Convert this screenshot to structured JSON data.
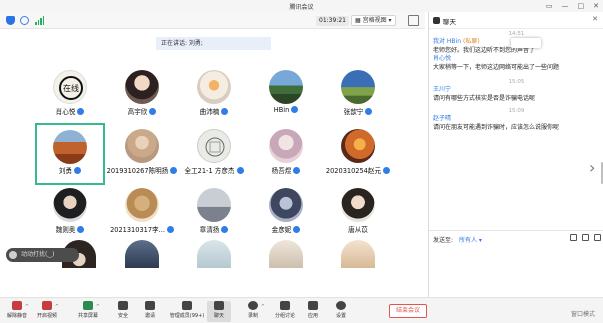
{
  "window": {
    "title": "腾讯会议",
    "controls": [
      "▭",
      "—",
      "□",
      "✕"
    ]
  },
  "topbar": {
    "timer": "01:39:21",
    "view_mode": "▦ 宫格视图 ▾",
    "icons": [
      "shield-icon",
      "info-icon",
      "signal-icon",
      "fullscreen-icon"
    ]
  },
  "speaker_banner": "正在讲话: 刘勇;",
  "participants": [
    {
      "name": "肖心悦",
      "mic_on": true
    },
    {
      "name": "高宇欣",
      "mic_on": true
    },
    {
      "name": "曲沛楠",
      "mic_on": true
    },
    {
      "name": "HBin",
      "mic_on": true
    },
    {
      "name": "张歆宁",
      "mic_on": true
    },
    {
      "name": "刘勇",
      "mic_on": true,
      "active": true
    },
    {
      "name": "2019310267陈明扬",
      "mic_on": true
    },
    {
      "name": "全工21-1 方彦杰",
      "mic_on": true
    },
    {
      "name": "杨吾煜",
      "mic_on": true
    },
    {
      "name": "2020310254赵元",
      "mic_on": true
    },
    {
      "name": "魏则奥",
      "mic_on": true
    },
    {
      "name": "2021310317李...",
      "mic_on": true
    },
    {
      "name": "章清扬",
      "mic_on": true
    },
    {
      "name": "金彦妮",
      "mic_on": true
    },
    {
      "name": "唐从苡",
      "mic_on": false
    }
  ],
  "hand_button": "动动打扰(‿)",
  "bottom_toolbar": {
    "items": [
      {
        "label": "解除静音",
        "icon": "mic-icon"
      },
      {
        "label": "开启视频",
        "icon": "camera-icon"
      },
      {
        "label": "共享屏幕",
        "icon": "share-screen-icon"
      },
      {
        "label": "安全",
        "icon": "shield-icon"
      },
      {
        "label": "邀请",
        "icon": "invite-icon"
      },
      {
        "label": "管理成员(99+)",
        "icon": "members-icon"
      },
      {
        "label": "聊天",
        "icon": "chat-icon",
        "selected": true
      },
      {
        "label": "录制",
        "icon": "record-icon"
      },
      {
        "label": "分组讨论",
        "icon": "breakout-icon"
      },
      {
        "label": "应用",
        "icon": "apps-icon"
      },
      {
        "label": "设置",
        "icon": "settings-icon"
      }
    ],
    "leave_label": "结束会议",
    "window_mode": "窗口模式"
  },
  "chat": {
    "title": "聊天",
    "messages": [
      {
        "time": "14:51",
        "sender": "我对 HBin",
        "private_tag": "(私聊)",
        "text": "老师您好。我们这边听不到您的声音了"
      },
      {
        "time": "",
        "sender": "肖心悦",
        "private_tag": "",
        "text": "大家稍等一下，老师这边网络可能出了一些问题"
      },
      {
        "time": "15:05",
        "sender": "王川宁",
        "private_tag": "",
        "text": "请问有哪些方式核实是否是诈骗电话呢"
      },
      {
        "time": "15:09",
        "sender": "赵子晴",
        "private_tag": "",
        "text": "请问在朋友可能遇到诈骗时，应该怎么说服你呢"
      }
    ],
    "send_to_label": "发送至:",
    "send_to_target": "所有人 ▾"
  },
  "colors": {
    "accent": "#2f7de6",
    "active_border": "#39b98c",
    "leave": "#e05555",
    "private": "#e18b2b"
  }
}
